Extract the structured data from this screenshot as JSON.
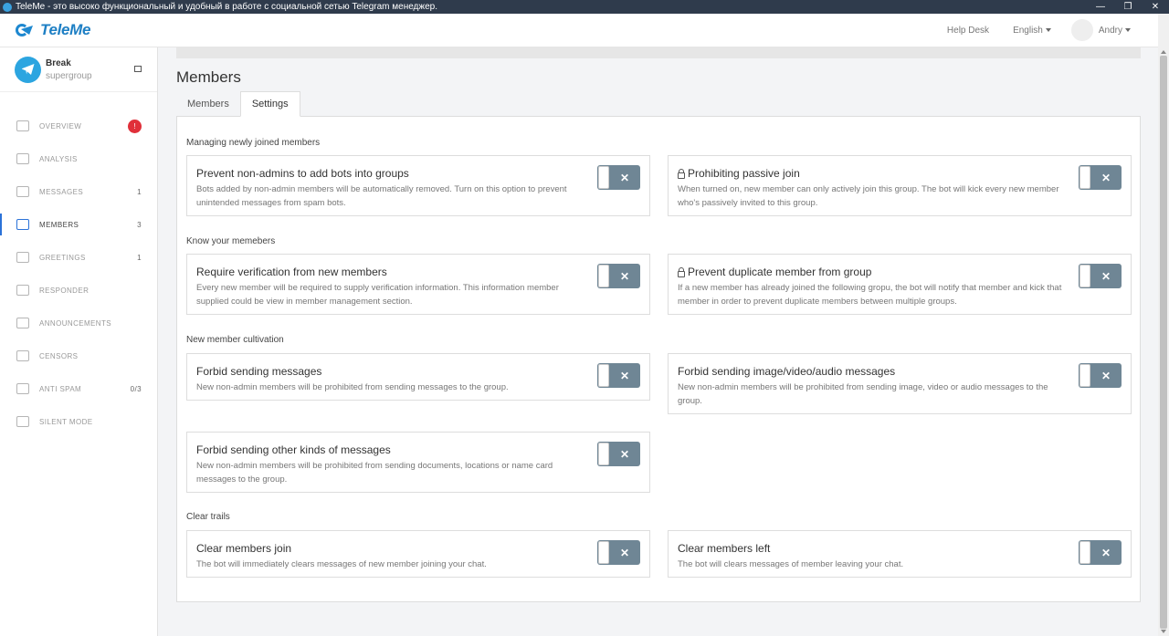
{
  "window": {
    "title": "TeleMe - это высоко функциональный и удобный в работе с социальной сетью Telegram менеджер.",
    "buttons": [
      "—",
      "❐",
      "✕"
    ]
  },
  "header": {
    "logo_text": "TeleMe",
    "help_desk": "Help Desk",
    "language": "English",
    "user": "Andry"
  },
  "group": {
    "name": "Break",
    "type": "supergroup"
  },
  "nav": [
    {
      "label": "OVERVIEW",
      "badge": "!"
    },
    {
      "label": "ANALYSIS",
      "count": ""
    },
    {
      "label": "MESSAGES",
      "count": "1"
    },
    {
      "label": "MEMBERS",
      "count": "3"
    },
    {
      "label": "GREETINGS",
      "count": "1"
    },
    {
      "label": "RESPONDER",
      "count": ""
    },
    {
      "label": "ANNOUNCEMENTS",
      "count": ""
    },
    {
      "label": "CENSORS",
      "count": ""
    },
    {
      "label": "ANTI SPAM",
      "count": "0/3"
    },
    {
      "label": "SILENT MODE",
      "count": ""
    }
  ],
  "page": {
    "title": "Members",
    "tabs": [
      "Members",
      "Settings"
    ]
  },
  "sections": [
    "Managing newly joined members",
    "Know your memebers",
    "New member cultivation",
    "Clear trails"
  ],
  "cards": [
    {
      "title": "Prevent non-admins to add bots into groups",
      "desc": "Bots added by non-admin members will be automatically removed. Turn on this option to prevent unintended messages from spam bots.",
      "enabled": false
    },
    {
      "title": "Prohibiting passive join",
      "desc": "When turned on, new member can only actively join this group. The bot will kick every new member who's passively invited to this group.",
      "enabled": false
    },
    {
      "title": "Require verification from new members",
      "desc": "Every new member will be required to supply verification information. This information member supplied could be view in member management section.",
      "enabled": false
    },
    {
      "title": "Prevent duplicate member from group",
      "desc": "If a new member has already joined the following gropu, the bot will notify that member and kick that member in order to prevent duplicate members between multiple groups.",
      "enabled": false
    },
    {
      "title": "Forbid sending messages",
      "desc": "New non-admin members will be prohibited from sending messages to the group.",
      "enabled": false
    },
    {
      "title": "Forbid sending image/video/audio messages",
      "desc": "New non-admin members will be prohibited from sending image, video or audio messages to the group.",
      "enabled": false
    },
    {
      "title": "Forbid sending other kinds of messages",
      "desc": "New non-admin members will be prohibited from sending documents, locations or name card messages to the group.",
      "enabled": false
    },
    {
      "title": "Clear members join",
      "desc": "The bot will immediately clears messages of new member joining your chat.",
      "enabled": false
    },
    {
      "title": "Clear members left",
      "desc": "The bot will clears messages of member leaving your chat.",
      "enabled": false
    }
  ],
  "toggle_off_symbol": "✕",
  "colors": {
    "accent": "#2b72d8",
    "toggle_off": "#6f8695",
    "badge": "#e0303a",
    "logo": "#1e7fc4"
  }
}
